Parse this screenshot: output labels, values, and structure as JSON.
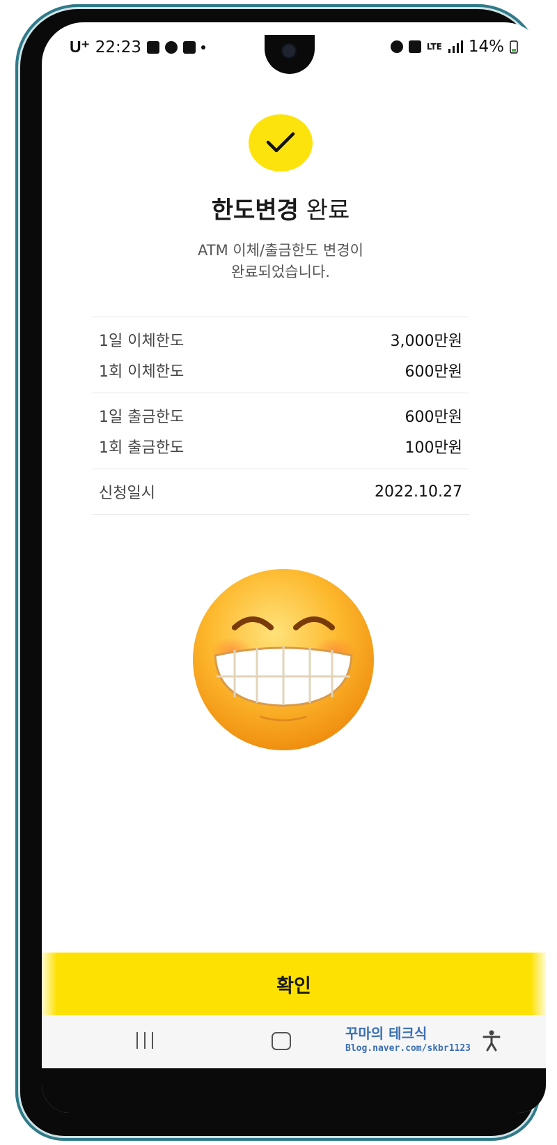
{
  "status_bar": {
    "carrier": "U⁺",
    "time": "22:23",
    "battery": "14%",
    "network": "LTE"
  },
  "content": {
    "title_bold": "한도변경",
    "title_rest": "완료",
    "subtitle_line1": "ATM 이체/출금한도 변경이",
    "subtitle_line2": "완료되었습니다.",
    "transfer": [
      {
        "label": "1일 이체한도",
        "value": "3,000만원"
      },
      {
        "label": "1회 이체한도",
        "value": "600만원"
      }
    ],
    "withdraw": [
      {
        "label": "1일 출금한도",
        "value": "600만원"
      },
      {
        "label": "1회 출금한도",
        "value": "100만원"
      }
    ],
    "applied": {
      "label": "신청일시",
      "value": "2022.10.27"
    }
  },
  "confirm_button": {
    "label": "확인"
  },
  "watermark": {
    "line1": "꾸마의 테크식",
    "line2": "Blog.naver.com/skbr1123"
  },
  "colors": {
    "accent": "#fde102"
  },
  "icons": {
    "check": "check-icon",
    "emoji": "grinning-face-icon",
    "recent": "recent-apps-icon",
    "home": "home-icon",
    "accessibility": "accessibility-icon"
  }
}
